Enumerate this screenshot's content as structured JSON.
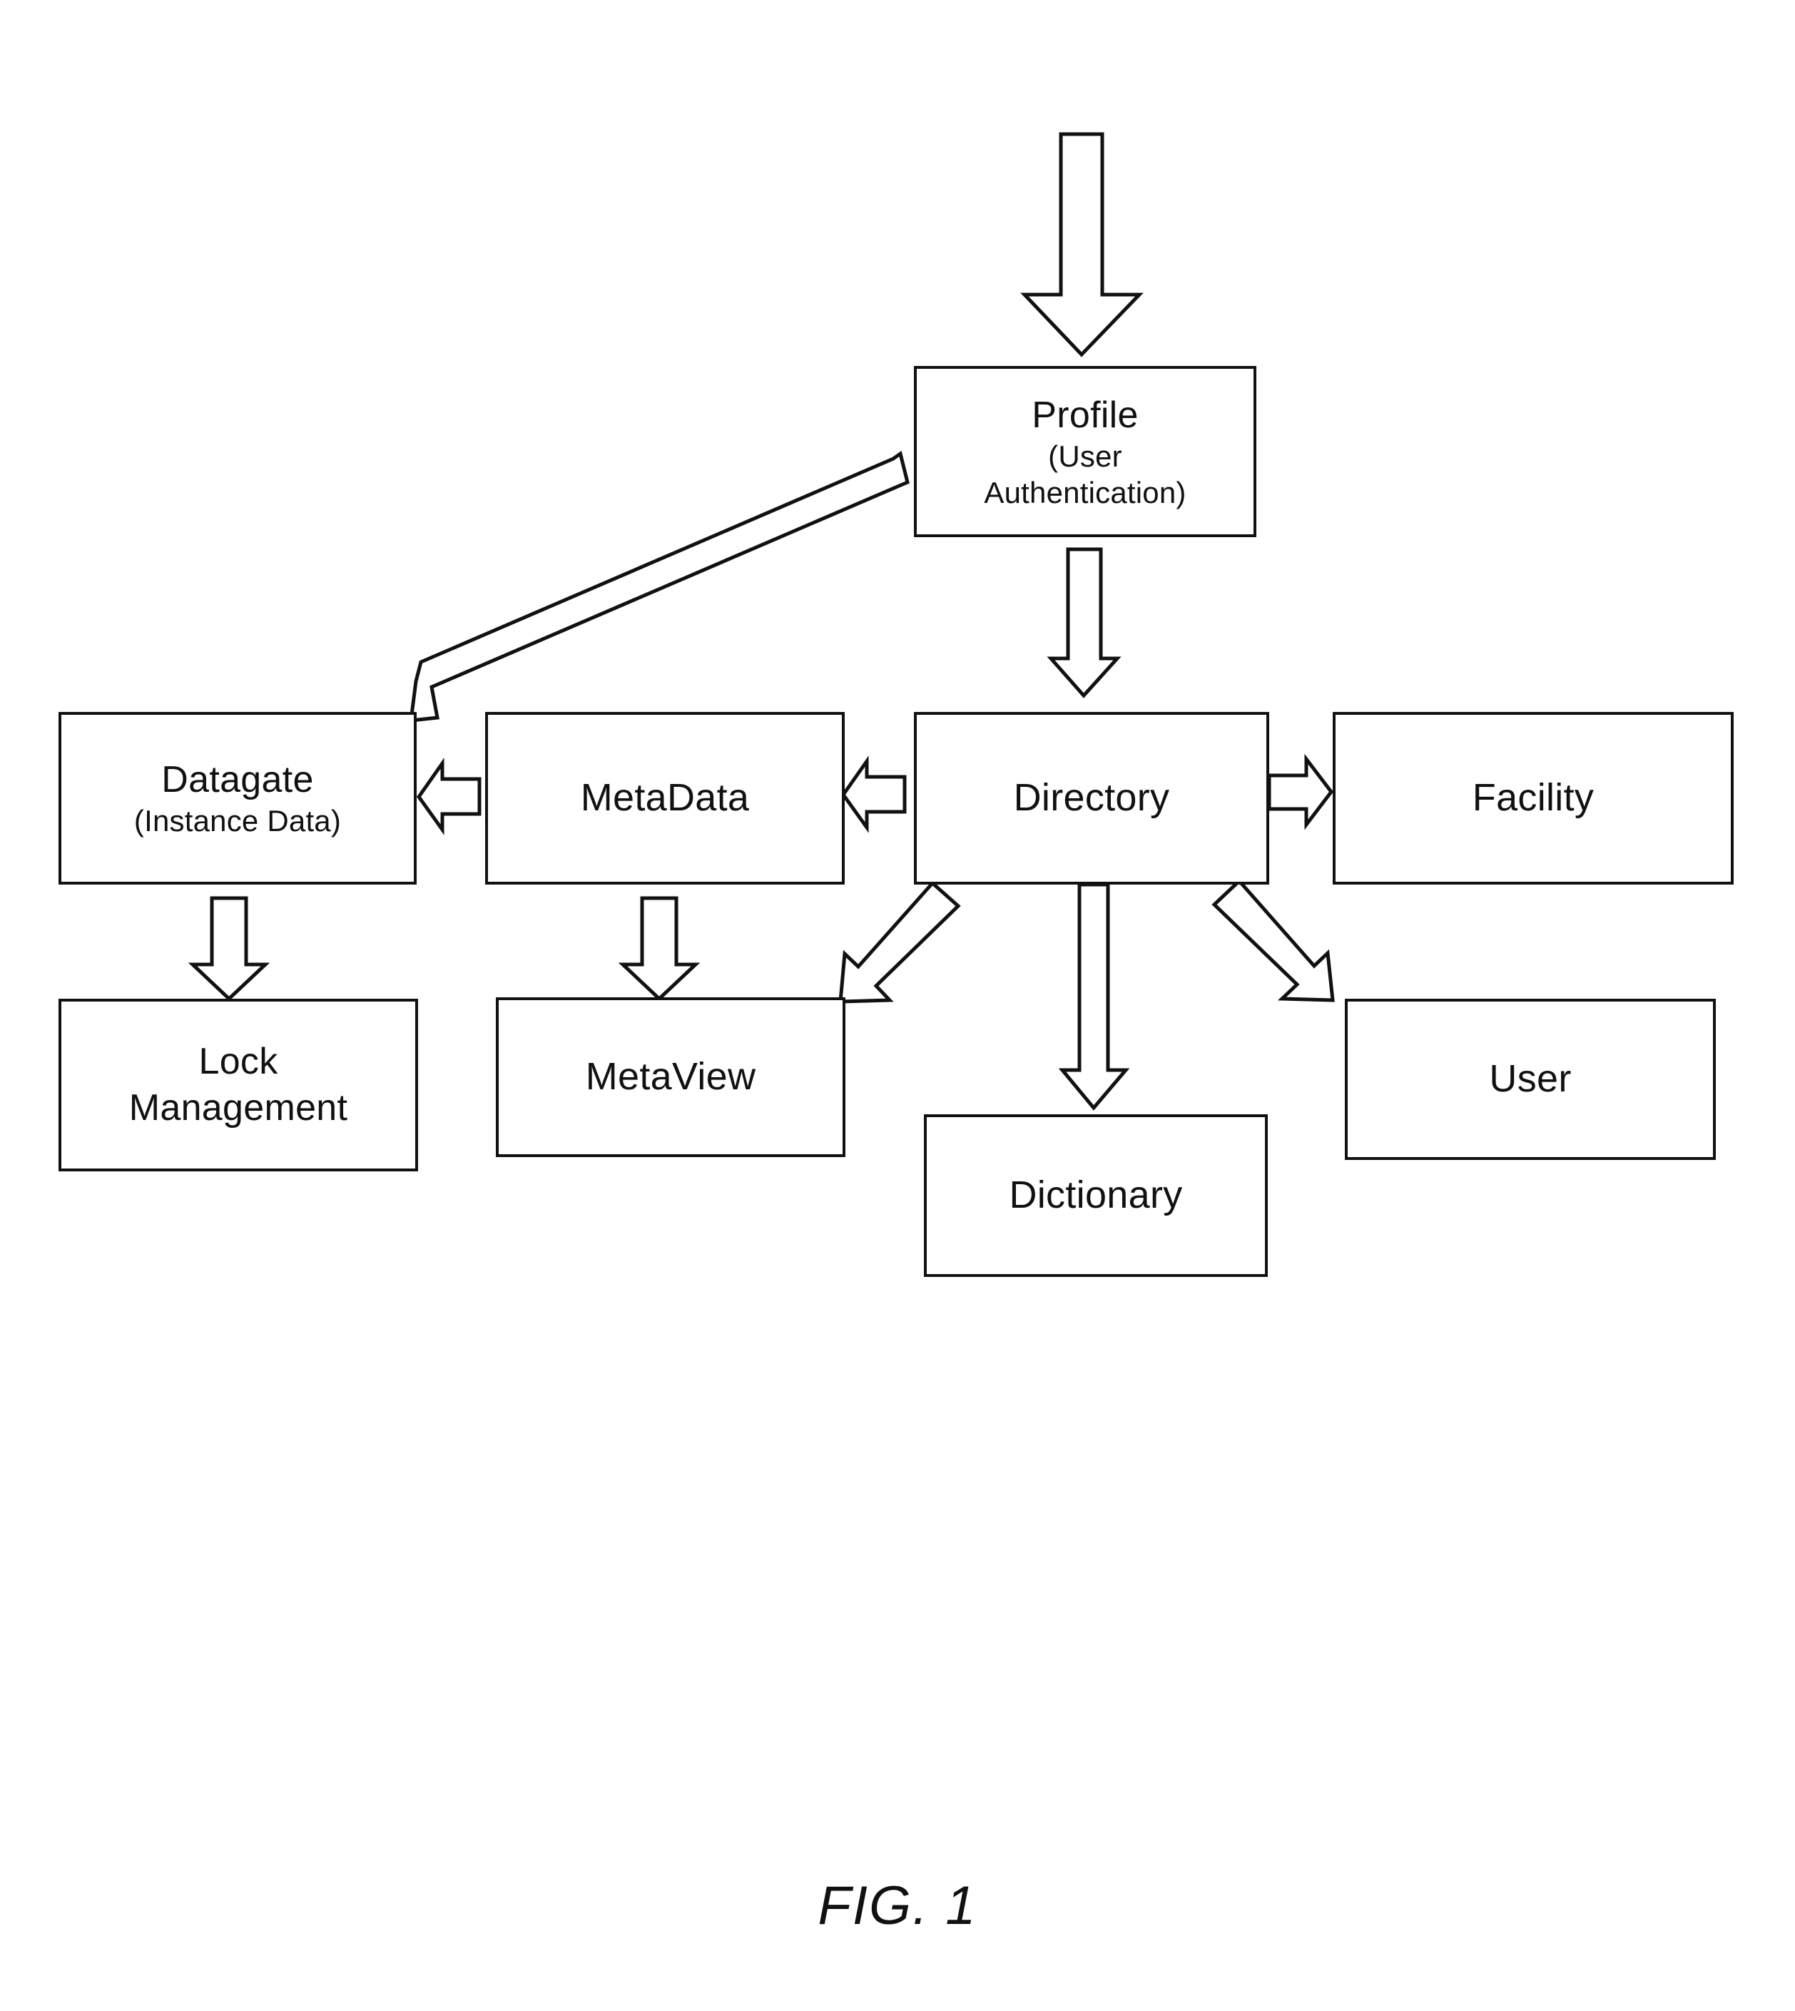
{
  "figure": {
    "caption": "FIG. 1",
    "type": "block-diagram"
  },
  "nodes": {
    "profile": {
      "label": "Profile",
      "sublabel_1": "(User",
      "sublabel_2": "Authentication)"
    },
    "datagate": {
      "label": "Datagate",
      "sublabel": "(Instance Data)"
    },
    "metadata": {
      "label": "MetaData"
    },
    "directory": {
      "label": "Directory"
    },
    "facility": {
      "label": "Facility"
    },
    "lock_management": {
      "label_1": "Lock",
      "label_2": "Management"
    },
    "metaview": {
      "label": "MetaView"
    },
    "dictionary": {
      "label": "Dictionary"
    },
    "user": {
      "label": "User"
    }
  },
  "connectors": [
    {
      "name": "input-to-profile",
      "from": "(external input)",
      "to": "profile",
      "direction": "down",
      "style": "hollow-block-arrow"
    },
    {
      "name": "profile-to-datagate",
      "from": "profile",
      "to": "datagate",
      "direction": "down-left",
      "style": "hollow-block-arrow"
    },
    {
      "name": "profile-to-directory",
      "from": "profile",
      "to": "directory",
      "direction": "down",
      "style": "hollow-block-arrow"
    },
    {
      "name": "directory-to-metadata",
      "from": "directory",
      "to": "metadata",
      "direction": "left",
      "style": "hollow-block-arrow"
    },
    {
      "name": "metadata-to-datagate",
      "from": "metadata",
      "to": "datagate",
      "direction": "left",
      "style": "hollow-block-arrow"
    },
    {
      "name": "directory-to-facility",
      "from": "directory",
      "to": "facility",
      "direction": "right",
      "style": "hollow-block-arrow"
    },
    {
      "name": "datagate-to-lock",
      "from": "datagate",
      "to": "lock_management",
      "direction": "down",
      "style": "hollow-block-arrow"
    },
    {
      "name": "metadata-to-metaview",
      "from": "metadata",
      "to": "metaview",
      "direction": "down",
      "style": "hollow-block-arrow"
    },
    {
      "name": "directory-to-metaview",
      "from": "directory",
      "to": "metaview",
      "direction": "down-left",
      "style": "hollow-block-arrow"
    },
    {
      "name": "directory-to-dictionary",
      "from": "directory",
      "to": "dictionary",
      "direction": "down",
      "style": "hollow-block-arrow"
    },
    {
      "name": "directory-to-user",
      "from": "directory",
      "to": "user",
      "direction": "down-right",
      "style": "hollow-block-arrow"
    }
  ],
  "colors": {
    "ink": "#111111",
    "background": "#ffffff"
  }
}
